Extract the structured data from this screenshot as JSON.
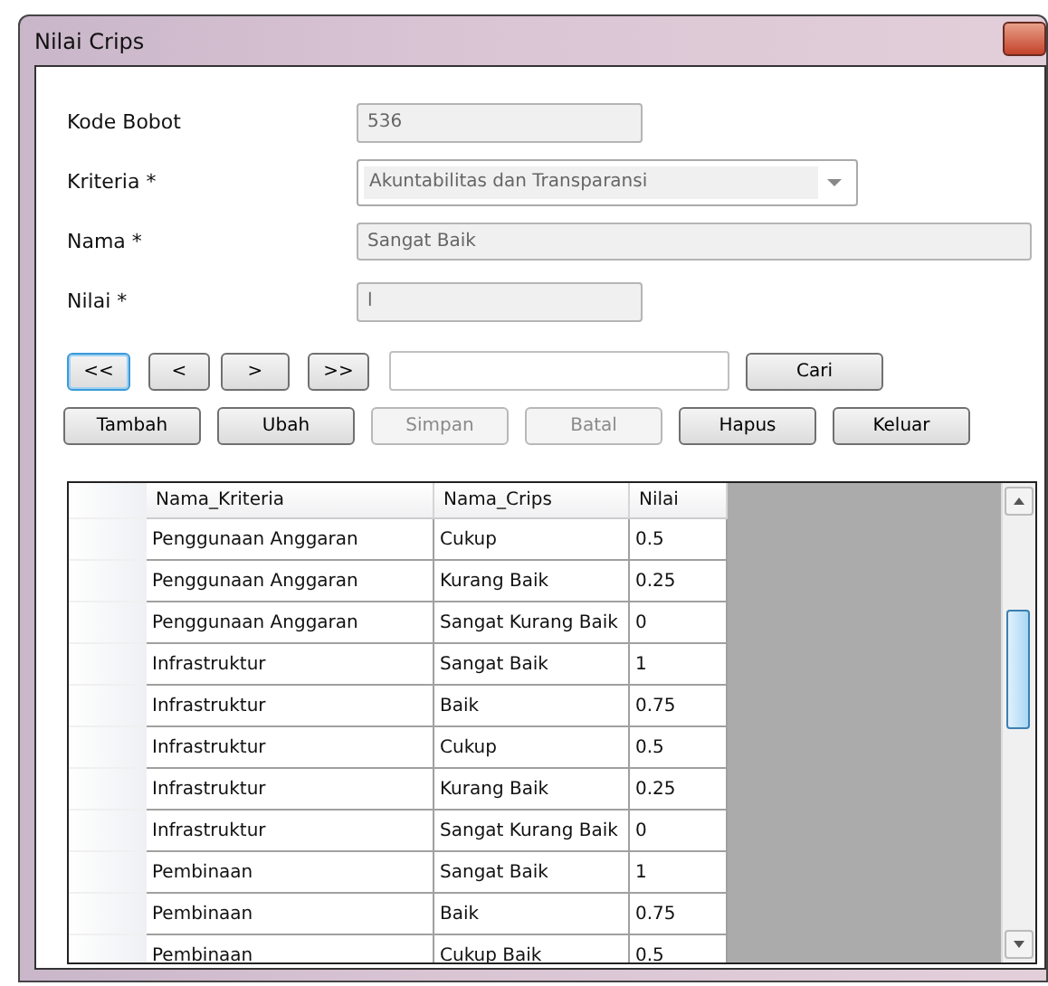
{
  "window": {
    "title": "Nilai Crips"
  },
  "fields": [
    {
      "label": "Kode Bobot",
      "value": "536",
      "kind": "text"
    },
    {
      "label": "Kriteria *",
      "value": "Akuntabilitas dan Transparansi",
      "kind": "combo"
    },
    {
      "label": "Nama *",
      "value": "Sangat Baik",
      "kind": "text"
    },
    {
      "label": "Nilai *",
      "value": "l",
      "kind": "text"
    }
  ],
  "navigation": [
    {
      "label": "<<",
      "focused": true
    },
    {
      "label": "<",
      "focused": false
    },
    {
      "label": ">",
      "focused": false
    },
    {
      "label": ">>",
      "focused": false
    }
  ],
  "search": {
    "button": "Cari"
  },
  "actions": [
    {
      "label": "Tambah",
      "disabled": false
    },
    {
      "label": "Ubah",
      "disabled": false
    },
    {
      "label": "Simpan",
      "disabled": true
    },
    {
      "label": "Batal",
      "disabled": true
    },
    {
      "label": "Hapus",
      "disabled": false
    },
    {
      "label": "Keluar",
      "disabled": false
    }
  ],
  "table": {
    "columns": [
      "Nama_Kriteria",
      "Nama_Crips",
      "Nilai"
    ],
    "rows": [
      [
        "Penggunaan Anggaran",
        "Cukup",
        "0.5"
      ],
      [
        "Penggunaan Anggaran",
        "Kurang Baik",
        "0.25"
      ],
      [
        "Penggunaan Anggaran",
        "Sangat Kurang Baik",
        "0"
      ],
      [
        "Infrastruktur",
        "Sangat Baik",
        "1"
      ],
      [
        "Infrastruktur",
        "Baik",
        "0.75"
      ],
      [
        "Infrastruktur",
        "Cukup",
        "0.5"
      ],
      [
        "Infrastruktur",
        "Kurang Baik",
        "0.25"
      ],
      [
        "Infrastruktur",
        "Sangat Kurang Baik",
        "0"
      ],
      [
        "Pembinaan",
        "Sangat Baik",
        "1"
      ],
      [
        "Pembinaan",
        "Baik",
        "0.75"
      ],
      [
        "Pembinaan",
        "Cukup Baik",
        "0.5"
      ]
    ]
  }
}
